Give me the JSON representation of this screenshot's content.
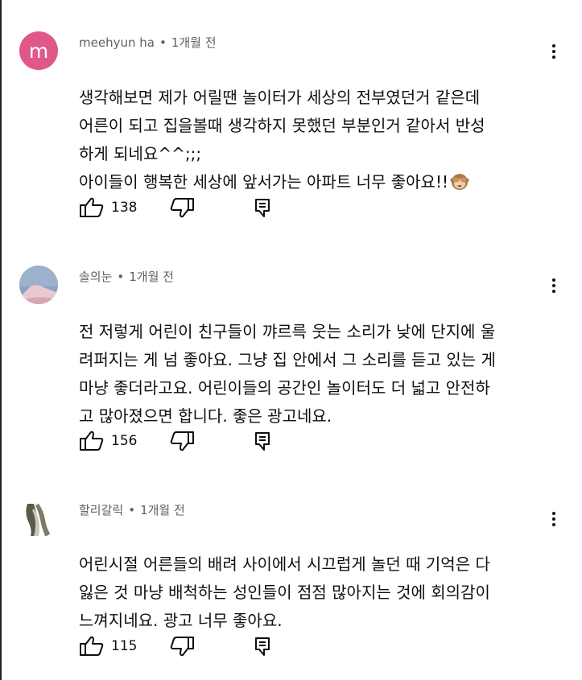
{
  "comments": [
    {
      "avatar_letter": "m",
      "author": "meehyun ha",
      "separator": "•",
      "time": "1개월 전",
      "text": "생각해보면 제가 어릴땐 놀이터가 세상의 전부였던거 같은데\n어른이 되고 집을볼때 생각하지 못했던 부분인거 같아서 반성\n하게 되네요^^;;;\n아이들이 행복한 세상에 앞서가는 아파트 너무 좋아요!!",
      "emoji": "see-no-evil-monkey",
      "likes": "138"
    },
    {
      "author": "솔의눈",
      "separator": "•",
      "time": "1개월 전",
      "text": "전 저렇게 어린이 친구들이 꺄르륵 웃는 소리가 낮에 단지에 울\n려퍼지는 게 넘 좋아요. 그냥 집 안에서 그 소리를 듣고 있는 게\n마냥 좋더라고요. 어린이들의 공간인 놀이터도 더 넓고 안전하\n고 많아졌으면 합니다. 좋은 광고네요.",
      "likes": "156"
    },
    {
      "author": "할리갈릭",
      "separator": "•",
      "time": "1개월 전",
      "text": "어린시절 어른들의 배려 사이에서 시끄럽게 놀던 때 기억은 다\n잃은 것 마냥 배척하는 성인들이 점점 많아지는 것에 회의감이\n느껴지네요. 광고 너무 좋아요.",
      "likes": "115"
    }
  ],
  "icons": {
    "like": "thumbs-up-icon",
    "dislike": "thumbs-down-icon",
    "reply": "reply-icon",
    "menu": "more-vert-icon"
  },
  "colors": {
    "avatar_m": "#e0578a",
    "meta_text": "#606060",
    "body_text": "#0f0f0f"
  }
}
